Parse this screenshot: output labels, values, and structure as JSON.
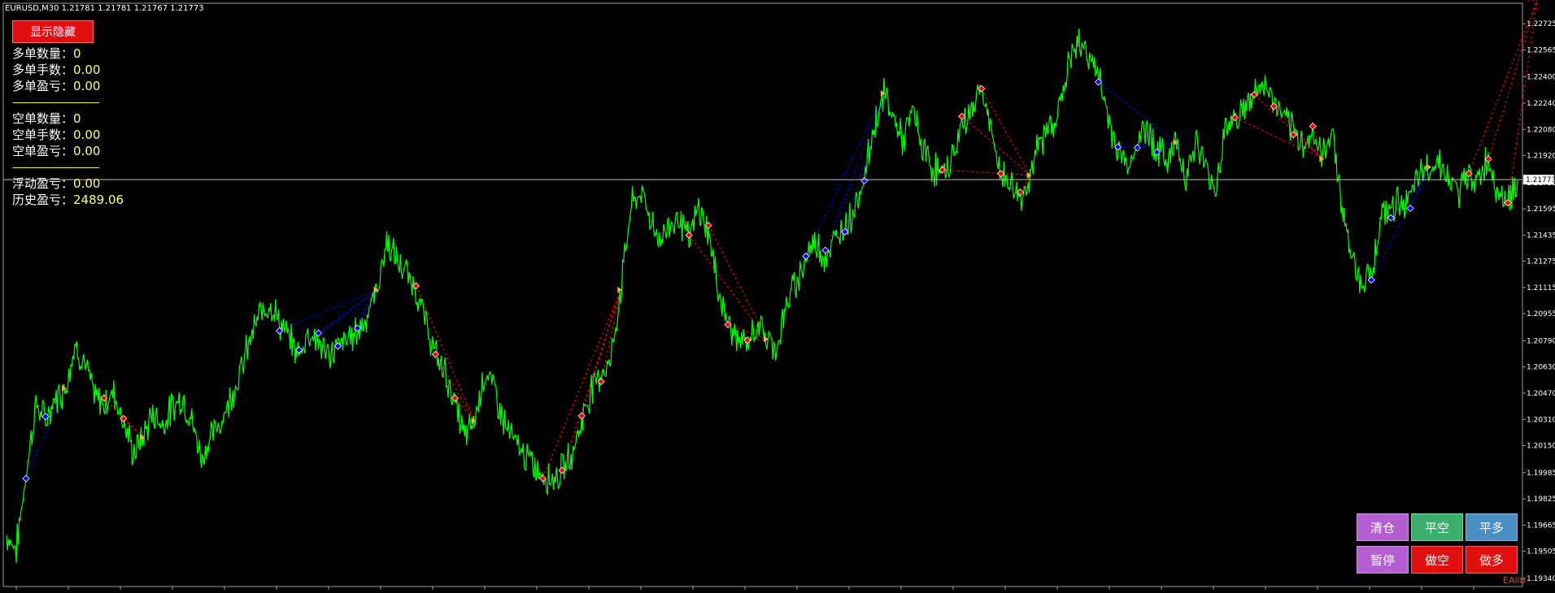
{
  "header": {
    "symbol_info": "EURUSD,M30  1.21781 1.21781 1.21767 1.21773"
  },
  "toggle_button": {
    "label": "显示隐藏"
  },
  "stats": {
    "long_count_label": "多单数量：",
    "long_count": "0",
    "long_lots_label": "多单手数：",
    "long_lots": "0.00",
    "long_pnl_label": "多单盈亏：",
    "long_pnl": "0.00",
    "separator": "--------------------------------",
    "short_count_label": "空单数量：",
    "short_count": "0",
    "short_lots_label": "空单手数：",
    "short_lots": "0.00",
    "short_pnl_label": "空单盈亏：",
    "short_pnl": "0.00",
    "floating_label": "浮动盈亏：",
    "floating": "0.00",
    "history_label": "历史盈亏：",
    "history": "2489.06"
  },
  "price_axis": {
    "labels": [
      "1.22725",
      "1.22565",
      "1.22400",
      "1.22240",
      "1.22080",
      "1.21920",
      "1.21755",
      "1.21595",
      "1.21435",
      "1.21275",
      "1.21115",
      "1.20955",
      "1.20790",
      "1.20630",
      "1.20470",
      "1.20310",
      "1.20150",
      "1.19985",
      "1.19825",
      "1.19665",
      "1.19505",
      "1.19340"
    ],
    "current_price": "1.21773"
  },
  "chart_data": {
    "type": "line",
    "symbol": "EURUSD",
    "timeframe": "M30",
    "last_price": 1.21773,
    "ylim": [
      1.193,
      1.2282
    ],
    "series": [
      {
        "values": [
          1.196,
          1.1952,
          1.1998,
          1.204,
          1.203,
          1.2044,
          1.205,
          1.2076,
          1.2066,
          1.2045,
          1.204,
          1.2048,
          1.203,
          1.201,
          1.202,
          1.2035,
          1.2028,
          1.2038,
          1.2045,
          1.203,
          1.2008,
          1.202,
          1.203,
          1.2045,
          1.206,
          1.208,
          1.2095,
          1.2103,
          1.209,
          1.208,
          1.207,
          1.2085,
          1.2078,
          1.207,
          1.2075,
          1.208,
          1.2085,
          1.2095,
          1.211,
          1.214,
          1.2128,
          1.212,
          1.211,
          1.209,
          1.207,
          1.206,
          1.204,
          1.202,
          1.203,
          1.206,
          1.205,
          1.203,
          1.2018,
          1.201,
          1.2003,
          1.1998,
          1.1995,
          1.2,
          1.201,
          1.203,
          1.205,
          1.206,
          1.2067,
          1.211,
          1.216,
          1.217,
          1.2155,
          1.214,
          1.215,
          1.2155,
          1.214,
          1.216,
          1.2145,
          1.211,
          1.209,
          1.208,
          1.2075,
          1.209,
          1.208,
          1.2075,
          1.21,
          1.2115,
          1.213,
          1.214,
          1.213,
          1.214,
          1.215,
          1.216,
          1.218,
          1.221,
          1.223,
          1.2215,
          1.22,
          1.222,
          1.2195,
          1.2185,
          1.218,
          1.219,
          1.221,
          1.222,
          1.2235,
          1.2205,
          1.218,
          1.2175,
          1.2165,
          1.218,
          1.22,
          1.221,
          1.222,
          1.225,
          1.226,
          1.2255,
          1.224,
          1.2215,
          1.2195,
          1.2185,
          1.22,
          1.221,
          1.2195,
          1.219,
          1.22,
          1.218,
          1.22,
          1.2185,
          1.217,
          1.221,
          1.2215,
          1.222,
          1.223,
          1.2235,
          1.2225,
          1.2215,
          1.2205,
          1.22,
          1.2205,
          1.219,
          1.221,
          1.216,
          1.213,
          1.2115,
          1.212,
          1.2155,
          1.216,
          1.2165,
          1.2165,
          1.218,
          1.2185,
          1.219,
          1.2175,
          1.217,
          1.218,
          1.2178,
          1.219,
          1.217,
          1.2165,
          1.2177
        ]
      }
    ],
    "trade_markers": {
      "long_color": "#0000ff",
      "short_color": "#ff0000",
      "line_style": "dashed"
    },
    "grid": false
  },
  "panel": {
    "buttons": [
      {
        "id": "clear",
        "label": "清仓",
        "color": "#b45fd0"
      },
      {
        "id": "close_short",
        "label": "平空",
        "color": "#3caf6e"
      },
      {
        "id": "close_long",
        "label": "平多",
        "color": "#4a8fc4"
      },
      {
        "id": "pause",
        "label": "暂停",
        "color": "#b45fd0"
      },
      {
        "id": "sell",
        "label": "做空",
        "color": "#e01010"
      },
      {
        "id": "buy",
        "label": "做多",
        "color": "#e01010"
      }
    ]
  },
  "colors": {
    "background": "#000000",
    "price_line": "#00ff00",
    "text_value": "#ffff66"
  },
  "watermark": "EAlib"
}
